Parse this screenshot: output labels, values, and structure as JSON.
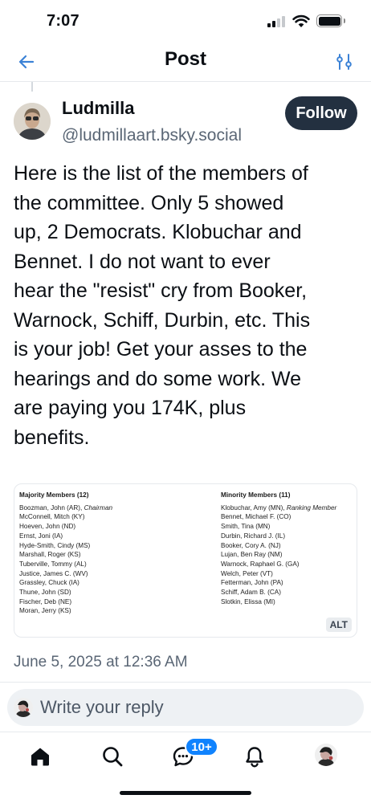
{
  "status_bar": {
    "time": "7:07",
    "icons": [
      "signal-icon",
      "wifi-icon",
      "battery-icon"
    ]
  },
  "header": {
    "title": "Post",
    "back_icon": "arrow-left-icon",
    "settings_icon": "sliders-icon"
  },
  "author": {
    "name": "Ludmilla",
    "handle": "@ludmillaart.bsky.social",
    "follow_label": "Follow"
  },
  "post": {
    "lines": [
      "Here is the list of the members of",
      "the committee. Only 5 showed",
      "up, 2 Democrats. Klobuchar and",
      "Bennet. I do not want to ever",
      "hear the \"resist\" cry from Booker,",
      "Warnock, Schiff, Durbin, etc. This",
      "is your job! Get your asses to the",
      "hearings and do some work. We",
      "are paying you 174K, plus",
      "benefits."
    ],
    "timestamp": "June 5, 2025 at 12:36 AM"
  },
  "embed_image": {
    "majority_header": "Majority Members (12)",
    "minority_header": "Minority Members (11)",
    "majority": [
      {
        "name": "Boozman, John (AR),",
        "note": "Chairman"
      },
      {
        "name": "McConnell, Mitch (KY)",
        "note": ""
      },
      {
        "name": "Hoeven, John (ND)",
        "note": ""
      },
      {
        "name": "Ernst, Joni (IA)",
        "note": ""
      },
      {
        "name": "Hyde-Smith, Cindy (MS)",
        "note": ""
      },
      {
        "name": "Marshall, Roger (KS)",
        "note": ""
      },
      {
        "name": "Tuberville, Tommy (AL)",
        "note": ""
      },
      {
        "name": "Justice, James C. (WV)",
        "note": ""
      },
      {
        "name": "Grassley, Chuck (IA)",
        "note": ""
      },
      {
        "name": "Thune, John (SD)",
        "note": ""
      },
      {
        "name": "Fischer, Deb (NE)",
        "note": ""
      },
      {
        "name": "Moran, Jerry (KS)",
        "note": ""
      }
    ],
    "minority": [
      {
        "name": "Klobuchar, Amy (MN),",
        "note": "Ranking Member"
      },
      {
        "name": "Bennet, Michael F. (CO)",
        "note": ""
      },
      {
        "name": "Smith, Tina (MN)",
        "note": ""
      },
      {
        "name": "Durbin, Richard J. (IL)",
        "note": ""
      },
      {
        "name": "Booker, Cory A. (NJ)",
        "note": ""
      },
      {
        "name": "Lujan, Ben Ray (NM)",
        "note": ""
      },
      {
        "name": "Warnock, Raphael G. (GA)",
        "note": ""
      },
      {
        "name": "Welch, Peter (VT)",
        "note": ""
      },
      {
        "name": "Fetterman, John (PA)",
        "note": ""
      },
      {
        "name": "Schiff, Adam B. (CA)",
        "note": ""
      },
      {
        "name": "Slotkin, Elissa (MI)",
        "note": ""
      }
    ],
    "alt_label": "ALT"
  },
  "reply": {
    "placeholder": "Write your reply"
  },
  "tabbar": {
    "tabs": [
      "home-icon",
      "search-icon",
      "chat-icon",
      "bell-icon",
      "profile-avatar"
    ],
    "badge": "10+"
  },
  "colors": {
    "follow_bg": "#233040",
    "badge_bg": "#1083fe",
    "accent": "#1083fe"
  }
}
